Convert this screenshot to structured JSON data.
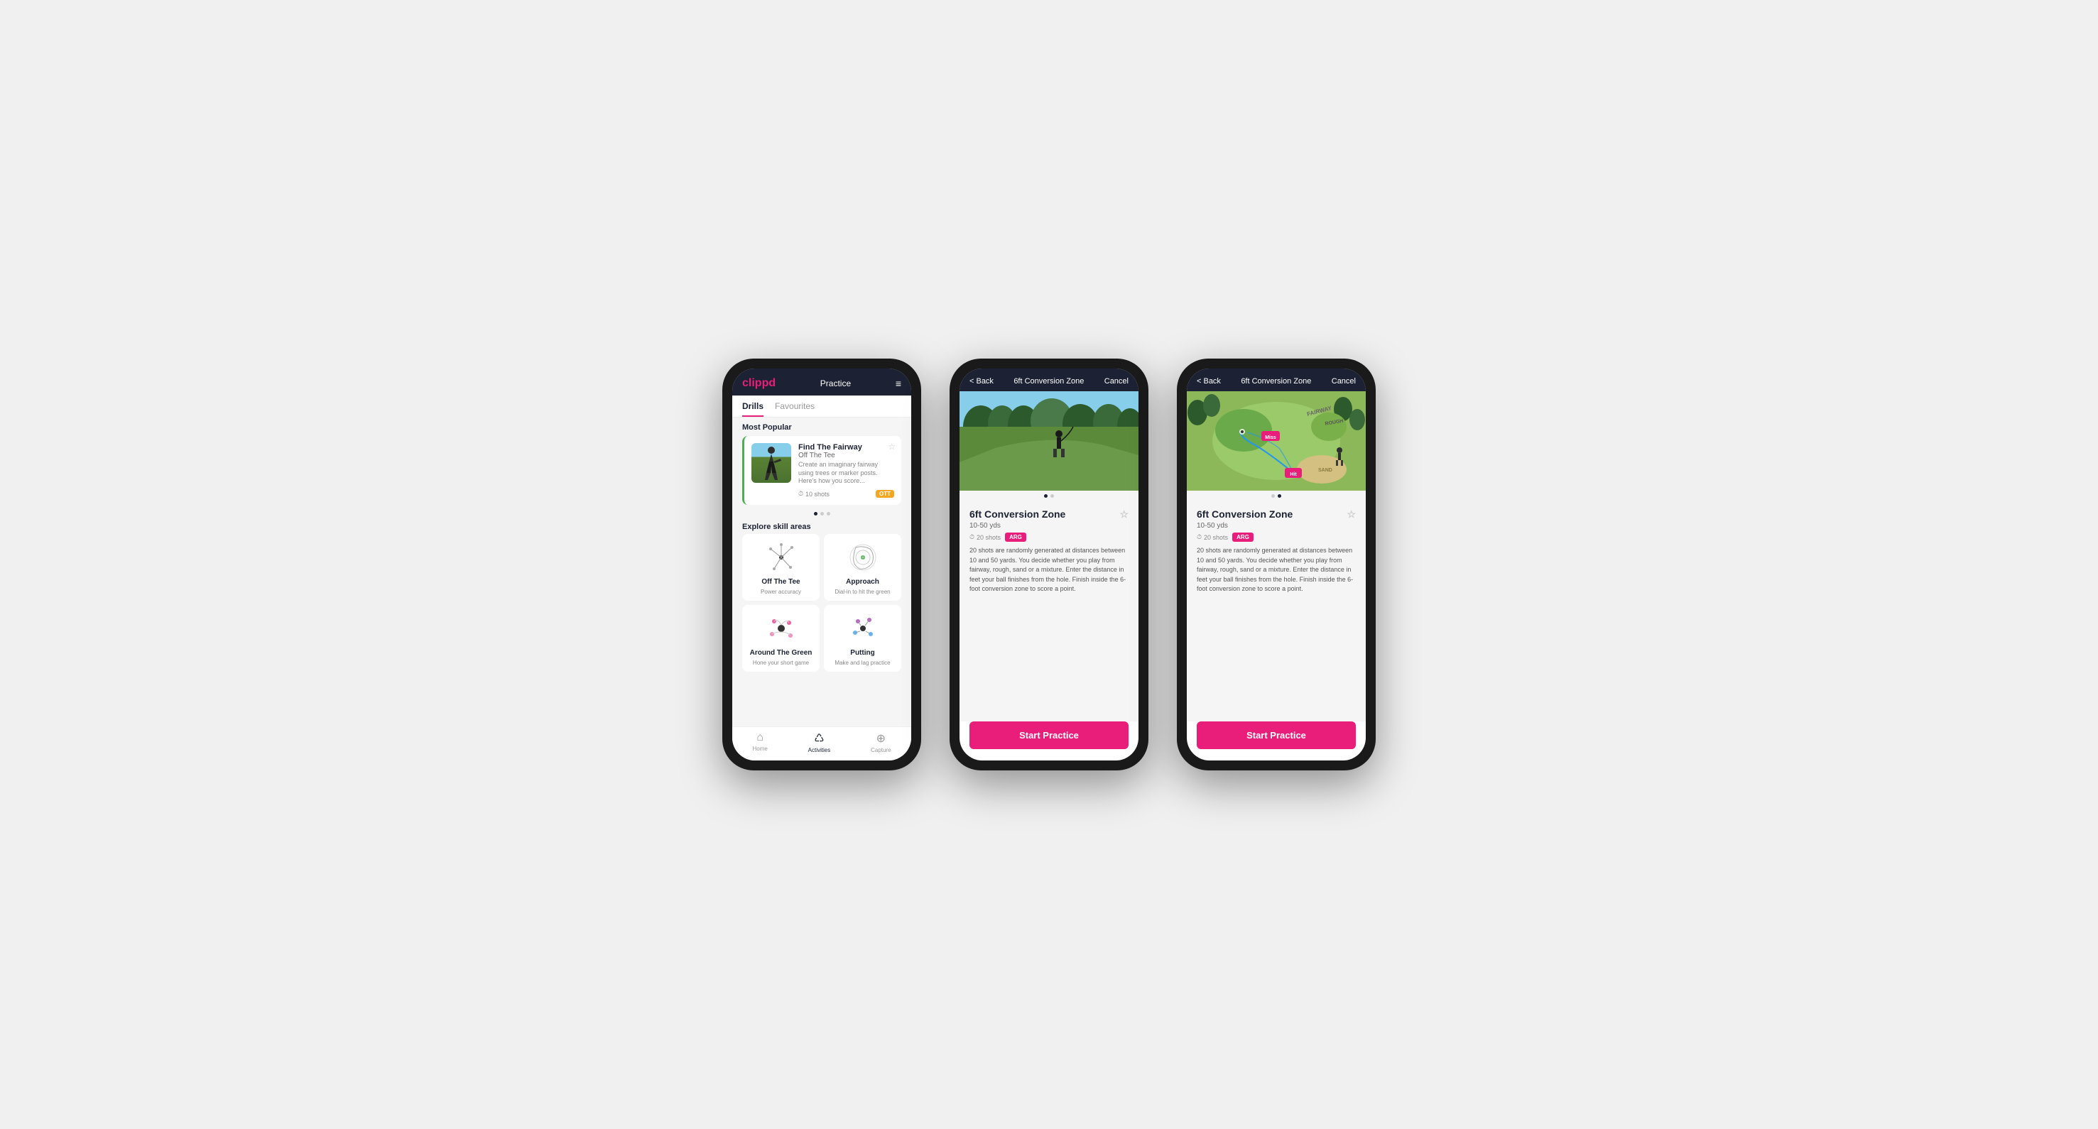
{
  "phone1": {
    "header": {
      "logo": "clippd",
      "nav_title": "Practice",
      "menu_icon": "≡"
    },
    "tabs": [
      {
        "label": "Drills",
        "active": true
      },
      {
        "label": "Favourites",
        "active": false
      }
    ],
    "most_popular_title": "Most Popular",
    "card": {
      "title": "Find The Fairway",
      "subtitle": "Off The Tee",
      "description": "Create an imaginary fairway using trees or marker posts. Here's how you score...",
      "shots": "10 shots",
      "badge": "OTT",
      "star_icon": "☆"
    },
    "explore_title": "Explore skill areas",
    "skills": [
      {
        "name": "Off The Tee",
        "desc": "Power accuracy"
      },
      {
        "name": "Approach",
        "desc": "Dial-in to hit the green"
      },
      {
        "name": "Around The Green",
        "desc": "Hone your short game"
      },
      {
        "name": "Putting",
        "desc": "Make and lag practice"
      }
    ],
    "bottom_nav": [
      {
        "icon": "⌂",
        "label": "Home",
        "active": false
      },
      {
        "icon": "♺",
        "label": "Activities",
        "active": true
      },
      {
        "icon": "⊕",
        "label": "Capture",
        "active": false
      }
    ]
  },
  "phone2": {
    "header": {
      "back_label": "< Back",
      "title": "6ft Conversion Zone",
      "cancel_label": "Cancel"
    },
    "drill": {
      "title": "6ft Conversion Zone",
      "yardage": "10-50 yds",
      "shots": "20 shots",
      "badge": "ARG",
      "star_icon": "☆",
      "description": "20 shots are randomly generated at distances between 10 and 50 yards. You decide whether you play from fairway, rough, sand or a mixture. Enter the distance in feet your ball finishes from the hole. Finish inside the 6-foot conversion zone to score a point."
    },
    "start_button": "Start Practice"
  },
  "phone3": {
    "header": {
      "back_label": "< Back",
      "title": "6ft Conversion Zone",
      "cancel_label": "Cancel"
    },
    "drill": {
      "title": "6ft Conversion Zone",
      "yardage": "10-50 yds",
      "shots": "20 shots",
      "badge": "ARG",
      "star_icon": "☆",
      "description": "20 shots are randomly generated at distances between 10 and 50 yards. You decide whether you play from fairway, rough, sand or a mixture. Enter the distance in feet your ball finishes from the hole. Finish inside the 6-foot conversion zone to score a point."
    },
    "start_button": "Start Practice"
  }
}
